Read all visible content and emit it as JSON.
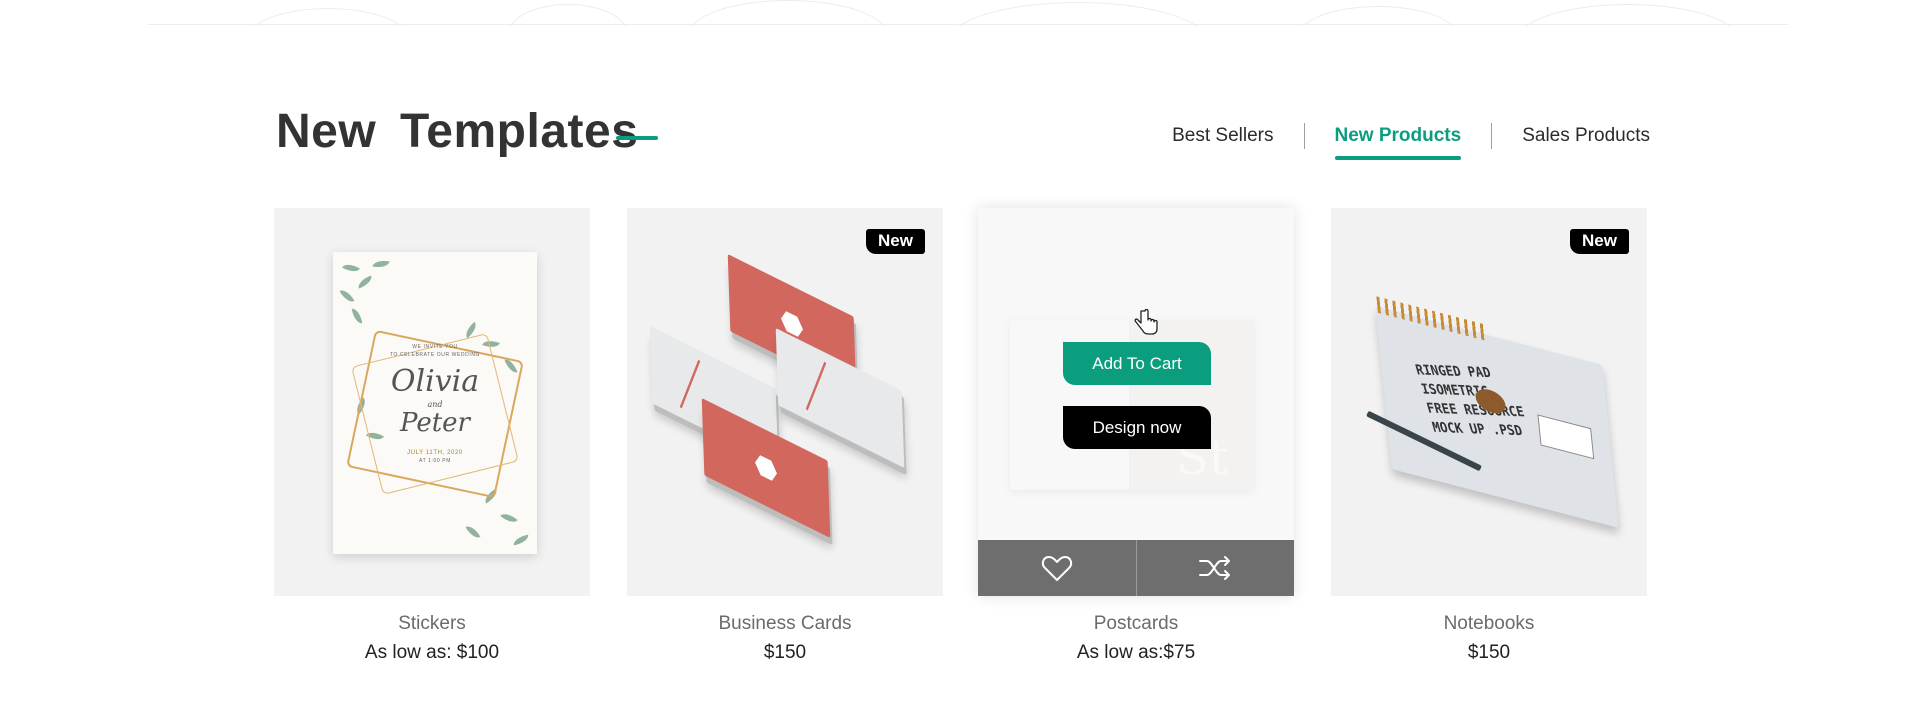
{
  "section": {
    "title": "New Templates"
  },
  "tabs": [
    {
      "label": "Best Sellers",
      "active": false
    },
    {
      "label": "New Products",
      "active": true
    },
    {
      "label": "Sales Products",
      "active": false
    }
  ],
  "colors": {
    "accent": "#0a9e7f",
    "badge": "#000000",
    "card_bg": "#f2f2f2",
    "action_bar": "#6e6e6e"
  },
  "products": [
    {
      "name": "Stickers",
      "price": "As low as: $100",
      "image": {
        "line1": "WE INVITE YOU",
        "line2": "TO CELEBRATE OUR WEDDING",
        "name1": "Olivia",
        "and": "and",
        "name2": "Peter",
        "date": "JULY 11TH, 2020",
        "time": "AT 1:00 PM"
      }
    },
    {
      "name": "Business Cards",
      "price": "$150",
      "badge": "New"
    },
    {
      "name": "Postcards",
      "price": "As low as:$75",
      "hover": {
        "add_to_cart": "Add To Cart",
        "design_now": "Design now",
        "wishlist_icon": "heart-icon",
        "compare_icon": "shuffle-icon"
      },
      "image": {
        "overlay_text": "St"
      }
    },
    {
      "name": "Notebooks",
      "price": "$150",
      "badge": "New",
      "image": {
        "line1": "RINGED PAD",
        "line2": "ISOMETRIC",
        "line3": "FREE RESOURCE",
        "line4": "MOCK UP .PSD"
      }
    }
  ]
}
